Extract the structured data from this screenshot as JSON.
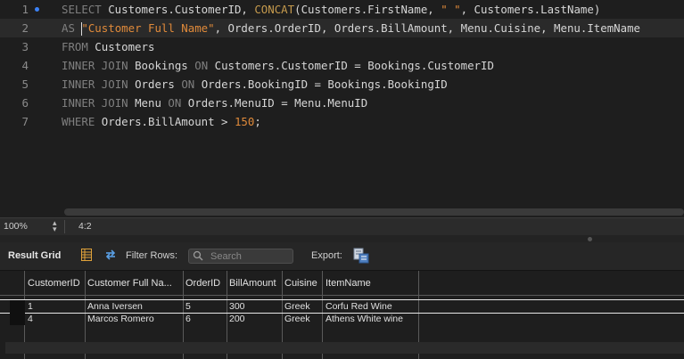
{
  "editor": {
    "lines": [
      {
        "number": "1",
        "tokens": [
          {
            "t": "SELECT",
            "c": "kw"
          },
          {
            "t": " Customers.CustomerID, "
          },
          {
            "t": "CONCAT",
            "c": "fn"
          },
          {
            "t": "(Customers.FirstName, "
          },
          {
            "t": "\" \"",
            "c": "str"
          },
          {
            "t": ", Customers.LastName)"
          }
        ]
      },
      {
        "number": "2",
        "tokens": [
          {
            "t": "AS",
            "c": "kw"
          },
          {
            "t": " "
          },
          {
            "caret": true
          },
          {
            "t": "\"Customer Full Name\"",
            "c": "str"
          },
          {
            "t": ", Orders.OrderID, Orders.BillAmount, Menu.Cuisine, Menu.ItemName"
          }
        ]
      },
      {
        "number": "3",
        "tokens": [
          {
            "t": "FROM",
            "c": "kw"
          },
          {
            "t": " Customers"
          }
        ]
      },
      {
        "number": "4",
        "tokens": [
          {
            "t": "INNER",
            "c": "kw"
          },
          {
            "t": " "
          },
          {
            "t": "JOIN",
            "c": "kw"
          },
          {
            "t": " Bookings "
          },
          {
            "t": "ON",
            "c": "kw"
          },
          {
            "t": " Customers.CustomerID = Bookings.CustomerID"
          }
        ]
      },
      {
        "number": "5",
        "tokens": [
          {
            "t": "INNER",
            "c": "kw"
          },
          {
            "t": " "
          },
          {
            "t": "JOIN",
            "c": "kw"
          },
          {
            "t": " Orders "
          },
          {
            "t": "ON",
            "c": "kw"
          },
          {
            "t": " Orders.BookingID = Bookings.BookingID"
          }
        ]
      },
      {
        "number": "6",
        "tokens": [
          {
            "t": "INNER",
            "c": "kw"
          },
          {
            "t": " "
          },
          {
            "t": "JOIN",
            "c": "kw"
          },
          {
            "t": " Menu "
          },
          {
            "t": "ON",
            "c": "kw"
          },
          {
            "t": " Orders.MenuID = Menu.MenuID"
          }
        ]
      },
      {
        "number": "7",
        "tokens": [
          {
            "t": "WHERE",
            "c": "kw"
          },
          {
            "t": " Orders.BillAmount > "
          },
          {
            "t": "150",
            "c": "num"
          },
          {
            "t": ";"
          }
        ]
      }
    ]
  },
  "status": {
    "zoom": "100%",
    "cursor": "4:2"
  },
  "toolbar": {
    "title": "Result Grid",
    "filter_label": "Filter Rows:",
    "search_placeholder": "Search",
    "export_label": "Export:"
  },
  "grid": {
    "columns": [
      "CustomerID",
      "Customer Full Na...",
      "OrderID",
      "BillAmount",
      "Cuisine",
      "ItemName"
    ],
    "rows": [
      [
        "1",
        "Anna Iversen",
        "5",
        "300",
        "Greek",
        "Corfu Red Wine"
      ],
      [
        "4",
        "Marcos Romero",
        "6",
        "200",
        "Greek",
        "Athens White wine"
      ]
    ]
  },
  "colors": {
    "keyword": "#7f7f7f",
    "function": "#c59a4d",
    "string": "#e08a3a",
    "accent": "#3b82f6"
  }
}
